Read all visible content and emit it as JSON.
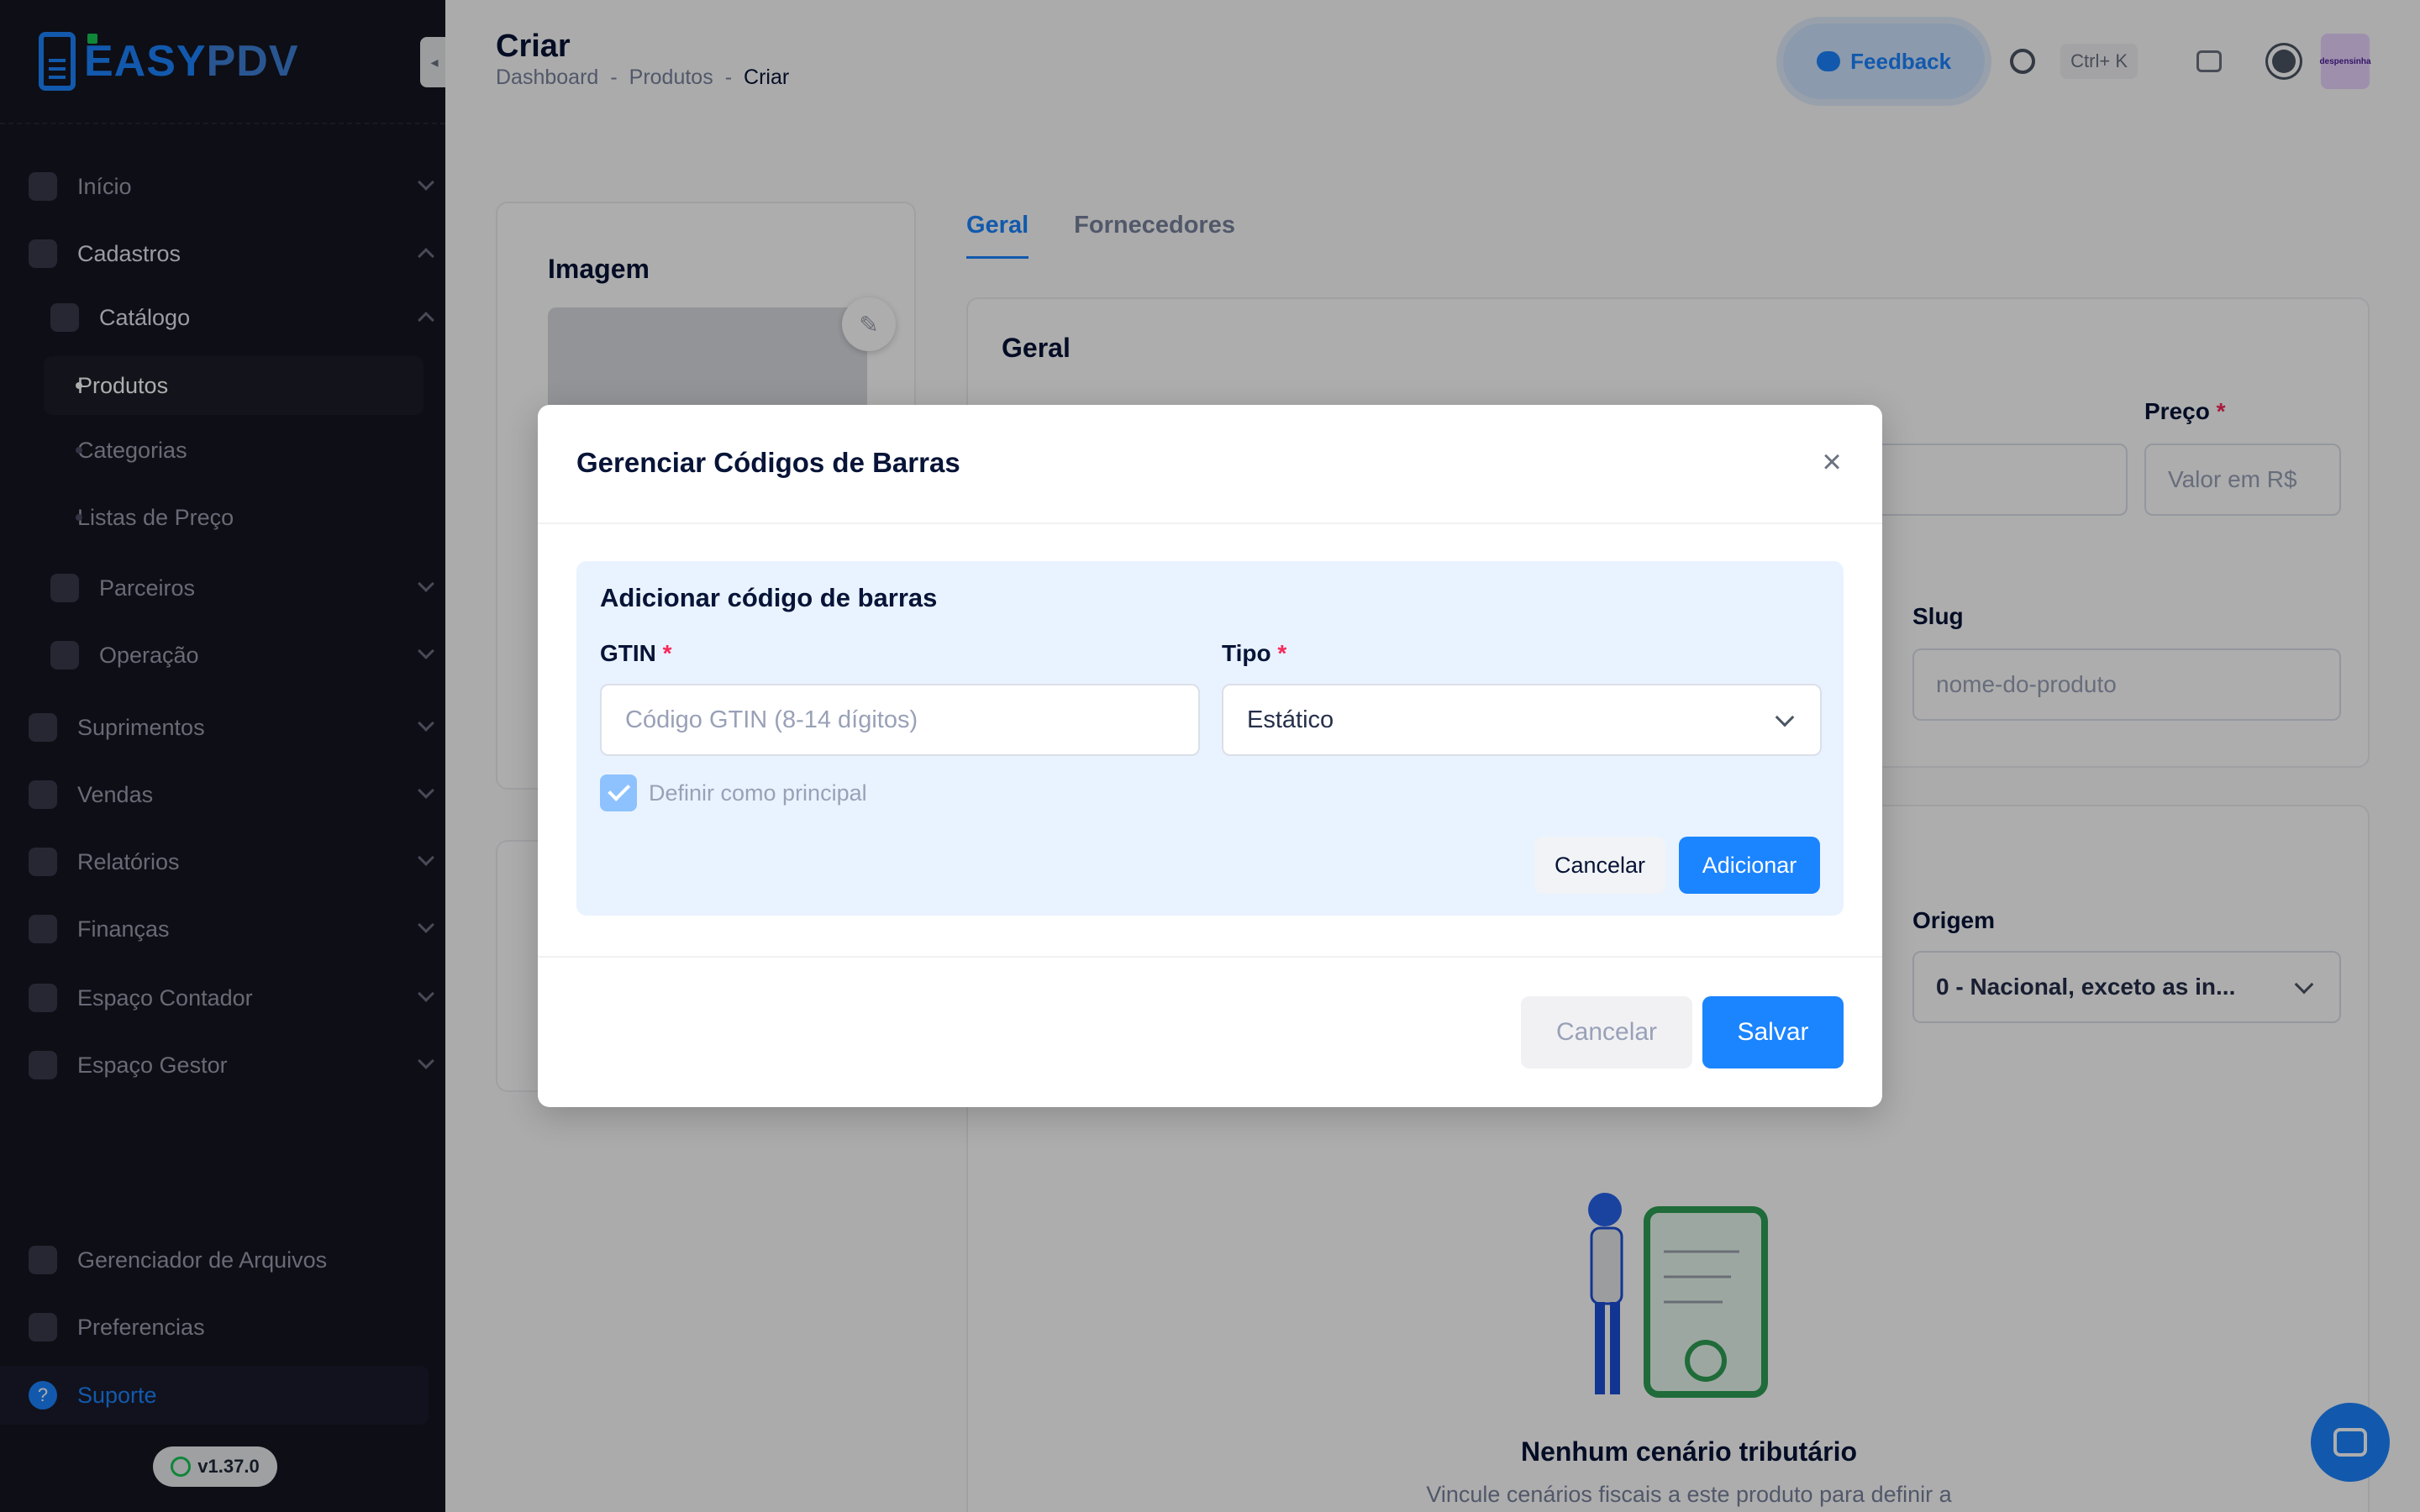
{
  "brand": {
    "name_left": "EASY",
    "name_right": "PDV"
  },
  "sidebar": {
    "items": [
      {
        "label": "Início",
        "icon": "grid-icon"
      },
      {
        "label": "Cadastros",
        "icon": "id-card-icon"
      },
      {
        "label": "Catálogo",
        "icon": "book-icon"
      },
      {
        "label": "Produtos"
      },
      {
        "label": "Categorias"
      },
      {
        "label": "Listas de Preço"
      },
      {
        "label": "Parceiros",
        "icon": "people-icon"
      },
      {
        "label": "Operação",
        "icon": "operation-icon"
      },
      {
        "label": "Suprimentos",
        "icon": "box-icon"
      },
      {
        "label": "Vendas",
        "icon": "cart-icon"
      },
      {
        "label": "Relatórios",
        "icon": "chart-icon"
      },
      {
        "label": "Finanças",
        "icon": "dollar-icon"
      },
      {
        "label": "Espaço Contador",
        "icon": "calculator-icon"
      },
      {
        "label": "Espaço Gestor",
        "icon": "manager-icon"
      }
    ],
    "bottom": [
      {
        "label": "Gerenciador de Arquivos",
        "icon": "folder-icon"
      },
      {
        "label": "Preferencias",
        "icon": "sliders-icon"
      },
      {
        "label": "Suporte",
        "icon": "help-icon"
      }
    ],
    "version": "v1.37.0"
  },
  "header": {
    "title": "Criar",
    "breadcrumb": [
      "Dashboard",
      "-",
      "Produtos",
      "-",
      "Criar"
    ],
    "feedback_label": "Feedback",
    "shortcut": "Ctrl+ K",
    "avatar_text": "despensinha"
  },
  "image_card": {
    "title": "Imagem"
  },
  "tabs": [
    "Geral",
    "Fornecedores"
  ],
  "general": {
    "title": "Geral",
    "price_label": "Preço",
    "price_placeholder": "Valor em R$",
    "slug_label": "Slug",
    "slug_placeholder": "nome-do-produto",
    "origin_label": "Origem",
    "origin_value": "0 - Nacional, exceto as in..."
  },
  "empty_state": {
    "title": "Nenhum cenário tributário",
    "description": "Vincule cenários fiscais a este produto para definir a"
  },
  "modal": {
    "title": "Gerenciar Códigos de Barras",
    "close_glyph": "×",
    "add_section": {
      "title": "Adicionar código de barras",
      "gtin_label": "GTIN",
      "gtin_placeholder": "Código GTIN (8-14 dígitos)",
      "type_label": "Tipo",
      "type_value": "Estático",
      "primary_checkbox_label": "Definir como principal",
      "primary_checked": true,
      "cancel_label": "Cancelar",
      "add_label": "Adicionar"
    },
    "footer": {
      "cancel_label": "Cancelar",
      "save_label": "Salvar"
    }
  },
  "required_mark": "*",
  "colors": {
    "primary": "#1b84ff",
    "sidebar_bg": "#151521",
    "panel_bg": "#e9f3ff",
    "required": "#f8285a"
  }
}
